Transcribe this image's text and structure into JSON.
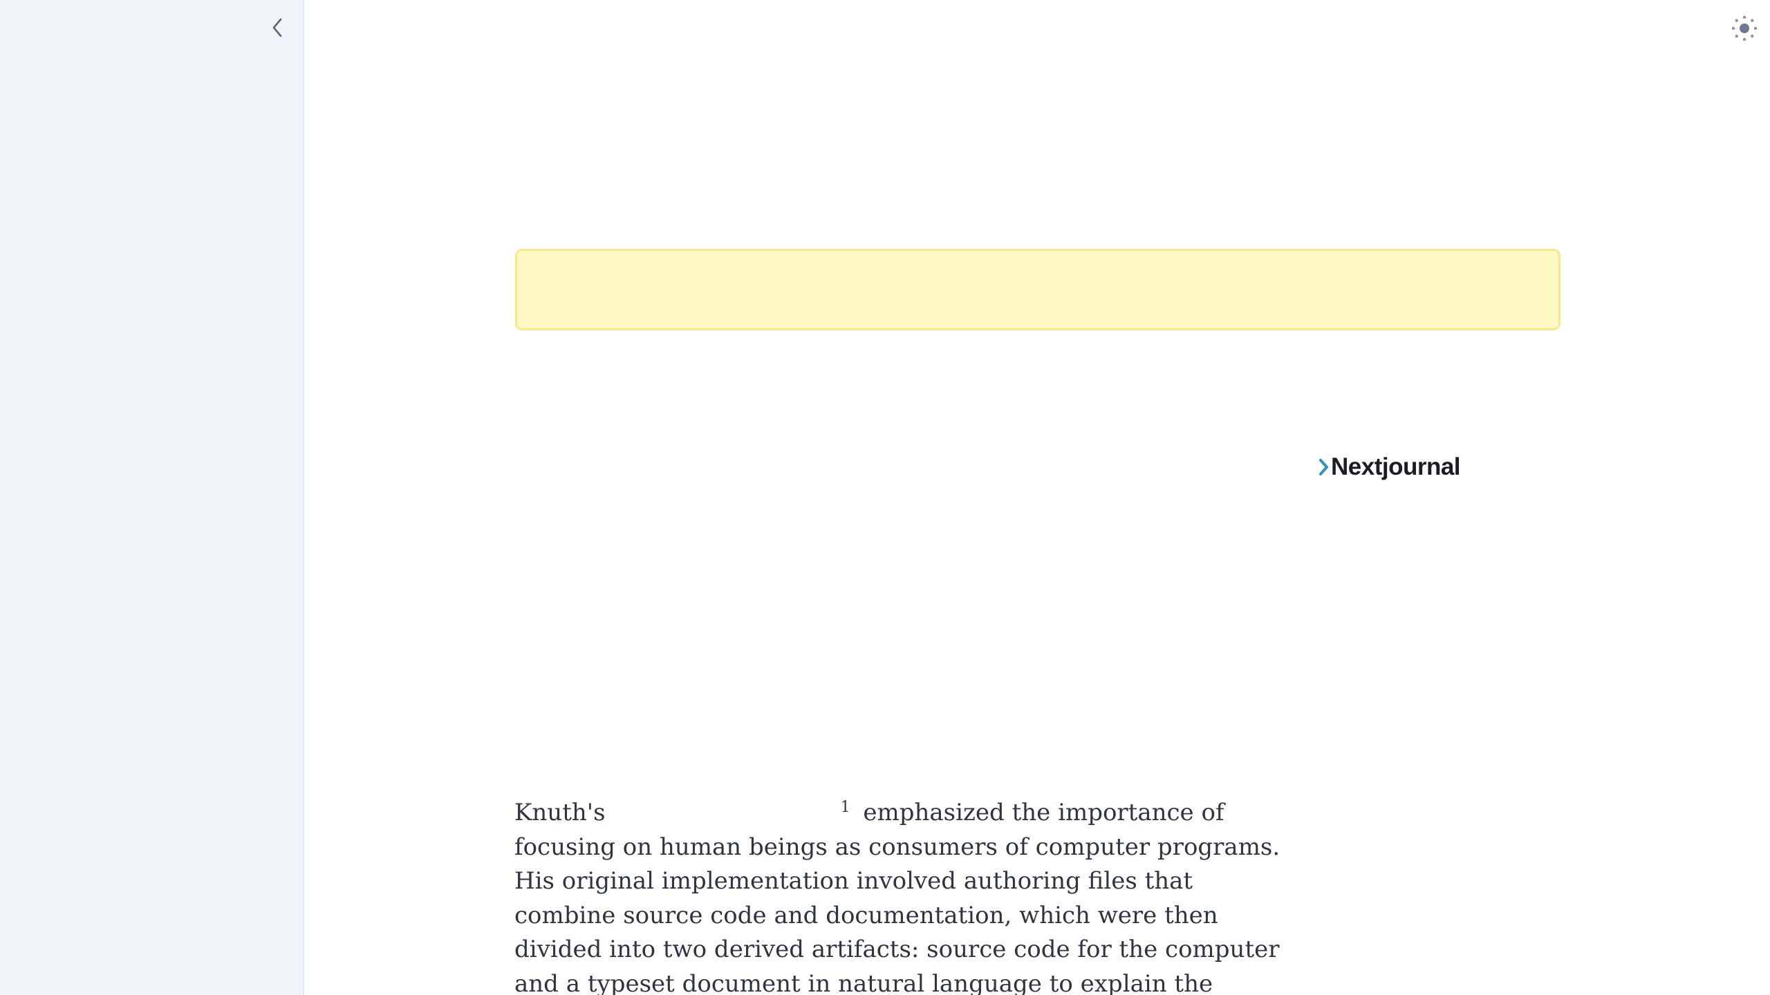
{
  "header": {
    "collapse_icon": "chevron-left-icon",
    "theme_icon": "sun-icon"
  },
  "logo": {
    "text": "Nextjournal",
    "chevron_color": "#2b93c5"
  },
  "article": {
    "intro_word": "Knuth's",
    "footnote_ref": "1",
    "text_after_ref": " emphasized the importance of focusing on human beings as consumers of computer programs. His original implementation involved authoring files that combine source code and documentation, which were then divided into two derived artifacts: source code for the computer and a typeset document in natural language to explain the program."
  },
  "colors": {
    "sidebar_bg": "#f0f3f8",
    "banner_bg": "#fef9c3",
    "banner_border": "#fde68a",
    "text": "#2f3441"
  }
}
